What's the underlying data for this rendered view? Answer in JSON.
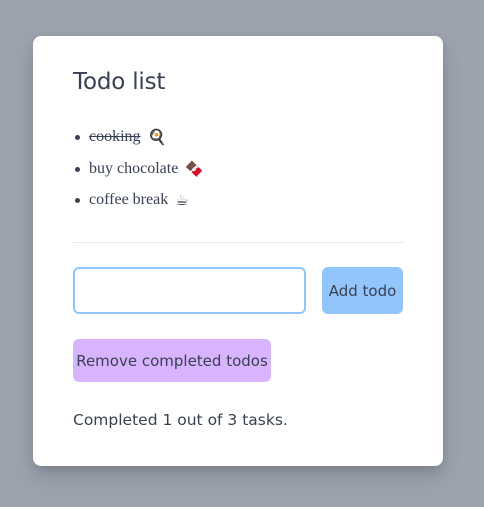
{
  "title": "Todo list",
  "todos": [
    {
      "text": "cooking",
      "emoji": "🍳",
      "completed": true
    },
    {
      "text": "buy chocolate",
      "emoji": "🍫",
      "completed": false
    },
    {
      "text": "coffee break",
      "emoji": "☕",
      "completed": false
    }
  ],
  "input": {
    "value": "",
    "placeholder": ""
  },
  "buttons": {
    "add_label": "Add todo",
    "remove_completed_label": "Remove completed todos"
  },
  "status_text": "Completed 1 out of 3 tasks.",
  "colors": {
    "background": "#9ca3af",
    "card": "#ffffff",
    "text": "#374151",
    "add_button": "#93c5fd",
    "input_border": "#93c5fd",
    "remove_button": "#d8b4fe",
    "divider": "#e5e7eb"
  }
}
